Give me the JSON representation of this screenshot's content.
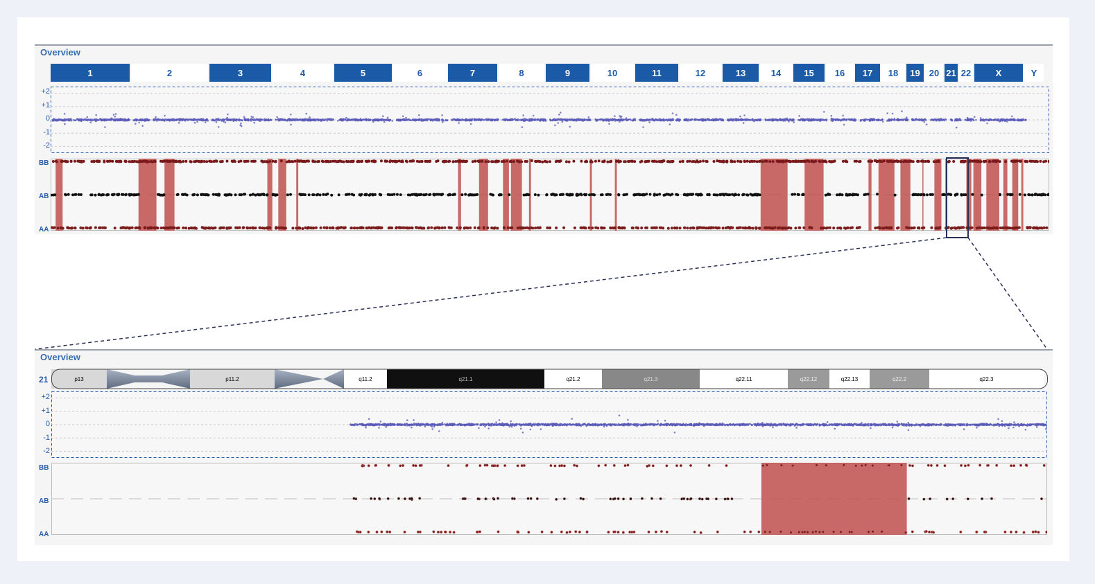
{
  "overview_title": "Overview",
  "zoom_title": "Overview",
  "zoom_chrom_label": "21",
  "chromosomes": [
    {
      "name": "1",
      "w": 116,
      "blue": true
    },
    {
      "name": "2",
      "w": 113,
      "blue": false
    },
    {
      "name": "3",
      "w": 91,
      "blue": true
    },
    {
      "name": "4",
      "w": 89,
      "blue": false
    },
    {
      "name": "5",
      "w": 85,
      "blue": true
    },
    {
      "name": "6",
      "w": 79,
      "blue": false
    },
    {
      "name": "7",
      "w": 73,
      "blue": true
    },
    {
      "name": "8",
      "w": 68,
      "blue": false
    },
    {
      "name": "9",
      "w": 65,
      "blue": true
    },
    {
      "name": "10",
      "w": 64,
      "blue": false
    },
    {
      "name": "11",
      "w": 64,
      "blue": true
    },
    {
      "name": "12",
      "w": 62,
      "blue": false
    },
    {
      "name": "13",
      "w": 54,
      "blue": true
    },
    {
      "name": "14",
      "w": 48,
      "blue": false
    },
    {
      "name": "15",
      "w": 47,
      "blue": true
    },
    {
      "name": "16",
      "w": 42,
      "blue": false
    },
    {
      "name": "17",
      "w": 38,
      "blue": true
    },
    {
      "name": "18",
      "w": 36,
      "blue": false
    },
    {
      "name": "19",
      "w": 27,
      "blue": true
    },
    {
      "name": "20",
      "w": 28,
      "blue": false
    },
    {
      "name": "21",
      "w": 21,
      "blue": true
    },
    {
      "name": "22",
      "w": 22,
      "blue": false
    },
    {
      "name": "X",
      "w": 72,
      "blue": true
    },
    {
      "name": "Y",
      "w": 30,
      "blue": false
    }
  ],
  "cn_ticks": [
    "+2",
    "+1",
    "0",
    "-1",
    "-2"
  ],
  "geno_ticks": [
    "BB",
    "AB",
    "AA"
  ],
  "cytobands": [
    {
      "name": "p13",
      "w": 80,
      "fill": "#d8d8d8",
      "text": "#000"
    },
    {
      "name": "",
      "w": 120,
      "fill": "centro",
      "text": "#000"
    },
    {
      "name": "p11.2",
      "w": 122,
      "fill": "#d8d8d8",
      "text": "#000"
    },
    {
      "name": "",
      "w": 100,
      "fill": "centro2",
      "text": "#000"
    },
    {
      "name": "q11.2",
      "w": 62,
      "fill": "#ffffff",
      "text": "#000"
    },
    {
      "name": "q21.1",
      "w": 227,
      "fill": "#101010",
      "text": "#bbb"
    },
    {
      "name": "q21.2",
      "w": 83,
      "fill": "#ffffff",
      "text": "#000"
    },
    {
      "name": "q21.3",
      "w": 141,
      "fill": "#888888",
      "text": "#ddd"
    },
    {
      "name": "q22.11",
      "w": 127,
      "fill": "#ffffff",
      "text": "#000"
    },
    {
      "name": "q22.12",
      "w": 60,
      "fill": "#9a9a9a",
      "text": "#eee"
    },
    {
      "name": "q22.13",
      "w": 58,
      "fill": "#ffffff",
      "text": "#000"
    },
    {
      "name": "q22.2",
      "w": 86,
      "fill": "#9a9a9a",
      "text": "#eee"
    },
    {
      "name": "q22.3",
      "w": 165,
      "fill": "#ffffff",
      "text": "#000"
    }
  ],
  "chart_data": [
    {
      "type": "scatter",
      "title": "Overview",
      "ylim": [
        -2,
        2
      ],
      "yticks": [
        "+2",
        "+1",
        "0",
        "-1",
        "-2"
      ],
      "series_color": "#5a5ab8",
      "loh_color": "#c0504d",
      "genotype_ticks": [
        "BB",
        "AB",
        "AA"
      ],
      "loh_regions_fraction": [
        [
          0.005,
          0.012
        ],
        [
          0.088,
          0.106
        ],
        [
          0.114,
          0.124
        ],
        [
          0.217,
          0.222
        ],
        [
          0.228,
          0.236
        ],
        [
          0.246,
          0.248
        ],
        [
          0.408,
          0.411
        ],
        [
          0.429,
          0.438
        ],
        [
          0.453,
          0.459
        ],
        [
          0.461,
          0.472
        ],
        [
          0.479,
          0.481
        ],
        [
          0.54,
          0.542
        ],
        [
          0.565,
          0.567
        ],
        [
          0.711,
          0.738
        ],
        [
          0.755,
          0.774
        ],
        [
          0.819,
          0.822
        ],
        [
          0.829,
          0.845
        ],
        [
          0.851,
          0.861
        ],
        [
          0.873,
          0.874
        ],
        [
          0.885,
          0.892
        ],
        [
          0.896,
          0.897
        ],
        [
          0.917,
          0.922
        ],
        [
          0.924,
          0.932
        ],
        [
          0.937,
          0.95
        ],
        [
          0.954,
          0.958
        ],
        [
          0.963,
          0.969
        ],
        [
          0.972,
          0.974
        ]
      ]
    },
    {
      "type": "scatter",
      "title": "Overview",
      "chromosome": "21",
      "ylim": [
        -2,
        2
      ],
      "yticks": [
        "+2",
        "+1",
        "0",
        "-1",
        "-2"
      ],
      "series_color": "#5a5ab8",
      "loh_color": "#c0504d",
      "genotype_ticks": [
        "BB",
        "AB",
        "AA"
      ],
      "data_start_fraction": 0.3,
      "loh_region_fraction": [
        0.713,
        0.859
      ]
    }
  ]
}
